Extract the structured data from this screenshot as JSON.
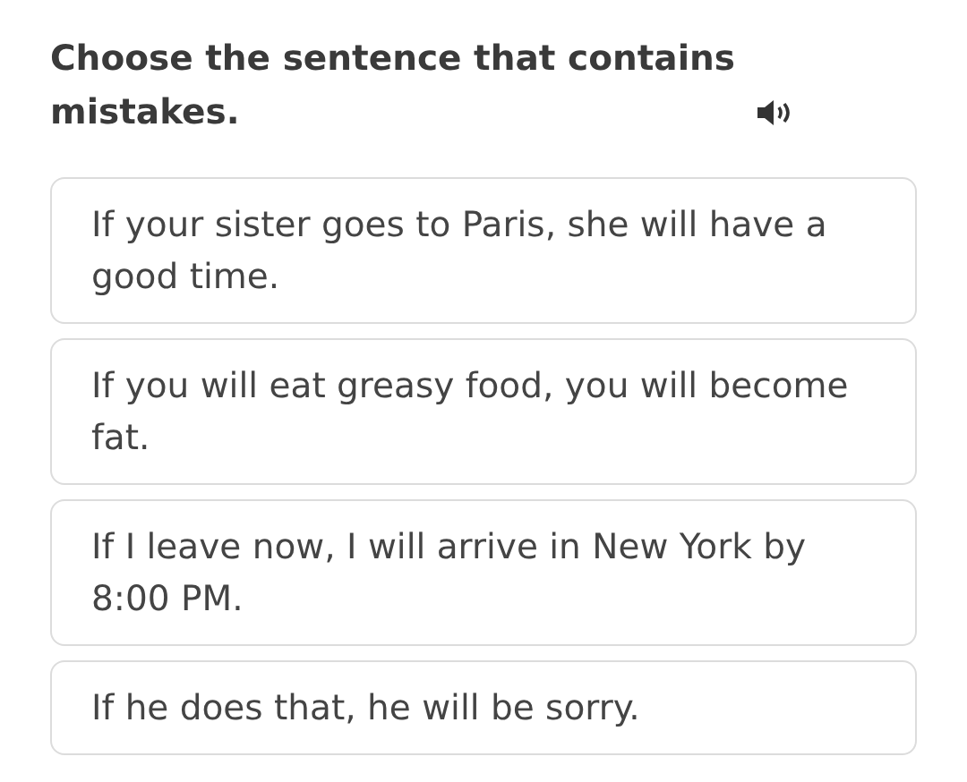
{
  "question": {
    "text": "Choose the sentence that contains mistakes."
  },
  "options": [
    {
      "text": "If your sister goes to Paris, she will have a good time.",
      "selected": false
    },
    {
      "text": "If you will eat greasy food, you will become fat.",
      "selected": false
    },
    {
      "text": "If I leave now, I will arrive in New York by 8:00 PM.",
      "selected": false
    },
    {
      "text": "If he does that, he will be sorry.",
      "selected": false
    }
  ]
}
